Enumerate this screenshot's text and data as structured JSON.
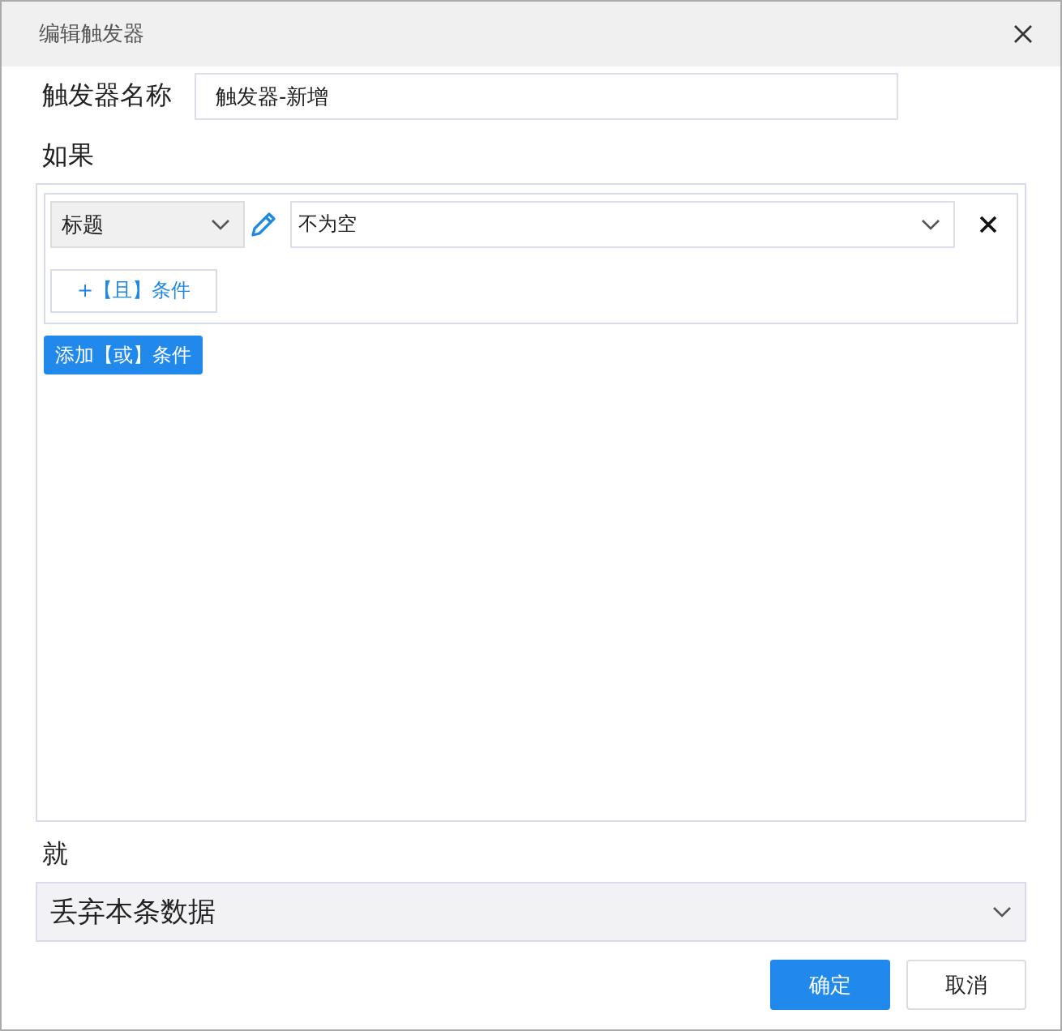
{
  "window": {
    "title": "编辑触发器"
  },
  "name_field": {
    "label": "触发器名称",
    "value": "触发器-新增"
  },
  "if_section": {
    "label": "如果",
    "groups": [
      {
        "conditions": [
          {
            "field": "标题",
            "operator": "不为空"
          }
        ],
        "and_button": "+【且】条件"
      }
    ],
    "or_button": "添加【或】条件"
  },
  "then_section": {
    "label": "就",
    "action": "丢弃本条数据"
  },
  "buttons": [
    {
      "label": "确定",
      "kind": "primary"
    },
    {
      "label": "取消",
      "kind": "secondary"
    }
  ]
}
